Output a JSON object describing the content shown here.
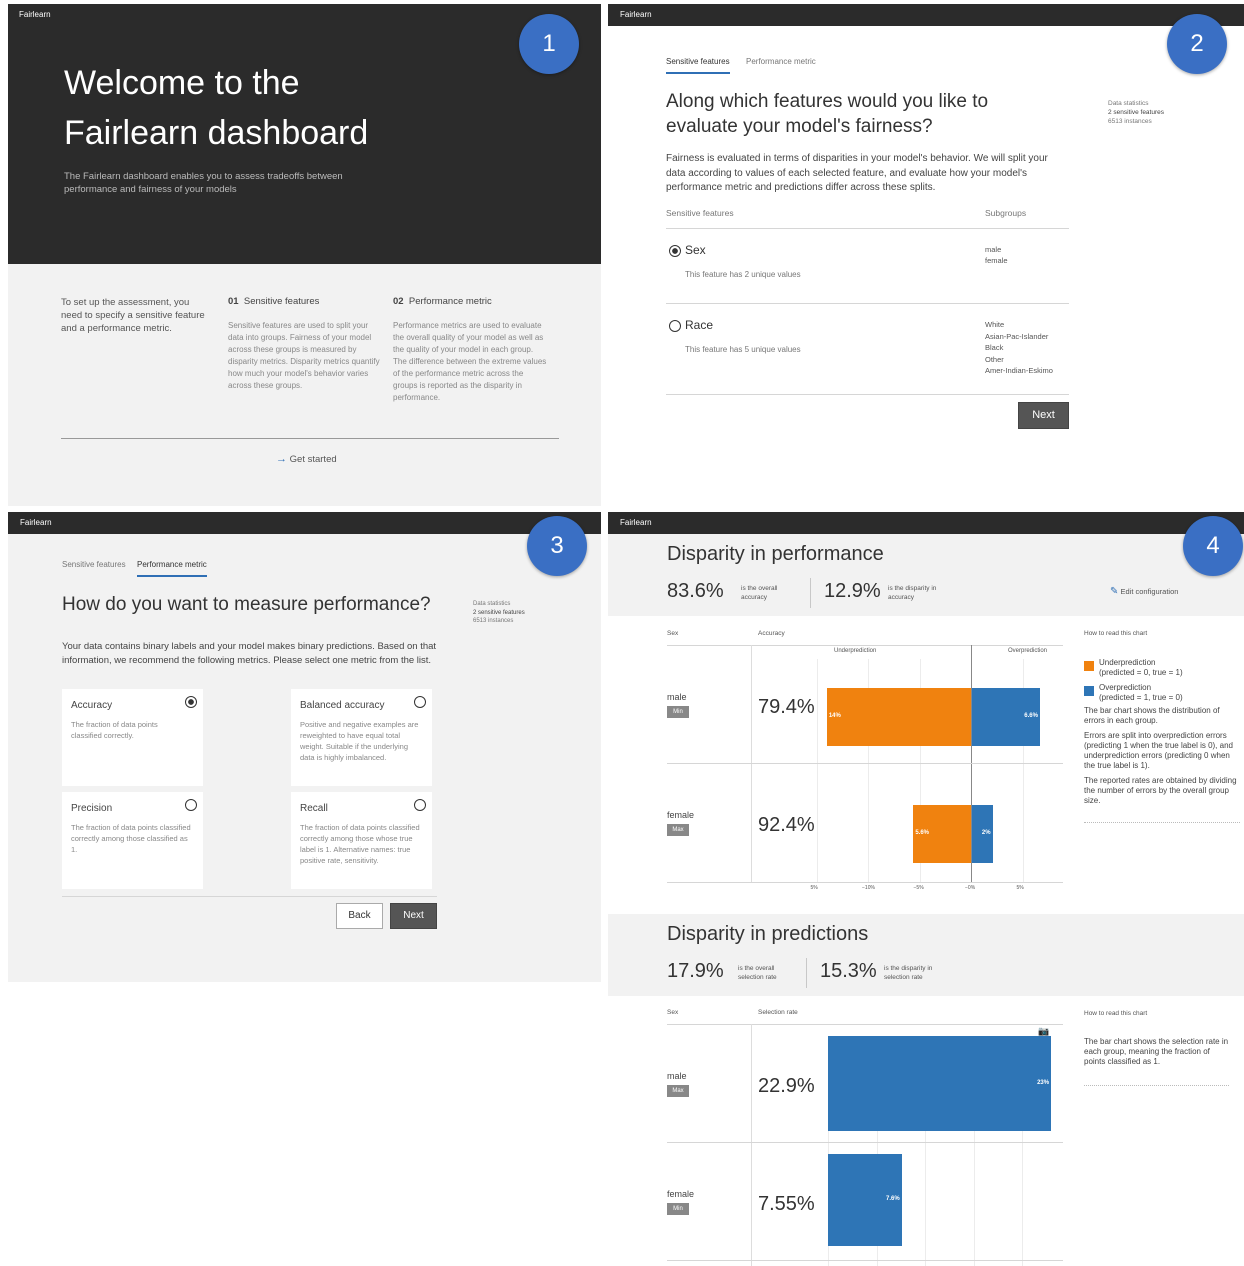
{
  "app_name": "Fairlearn",
  "badges": [
    "1",
    "2",
    "3",
    "4"
  ],
  "panel1": {
    "heading": "Welcome to the Fairlearn dashboard",
    "heading_line1": "Welcome to the",
    "heading_line2": "Fairlearn dashboard",
    "subtitle": "The Fairlearn dashboard enables you to assess tradeoffs between performance and fairness of your models",
    "intro": "To set up the assessment, you need to specify a sensitive feature and a performance metric.",
    "step1_num": "01",
    "step1_title": "Sensitive features",
    "step1_text": "Sensitive features are used to split your data into groups. Fairness of your model across these groups is measured by disparity metrics. Disparity metrics quantify how much your model's behavior varies across these groups.",
    "step2_num": "02",
    "step2_title": "Performance metric",
    "step2_text": "Performance metrics are used to evaluate the overall quality of your model as well as the quality of your model in each group. The difference between the extreme values of the performance metric across the groups is reported as the disparity in performance.",
    "get_started": "Get started"
  },
  "panel2": {
    "tabs": [
      "Sensitive features",
      "Performance metric"
    ],
    "heading": "Along which features would you like to evaluate your model's fairness?",
    "description": "Fairness is evaluated in terms of disparities in your model's behavior. We will split your data according to values of each selected feature, and evaluate how your model's performance metric and predictions differ across these splits.",
    "col_features": "Sensitive features",
    "col_subgroups": "Subgroups",
    "stats_title": "Data statistics",
    "stats_features": "2 sensitive features",
    "stats_instances": "6513 instances",
    "features": [
      {
        "name": "Sex",
        "selected": true,
        "note": "This feature has 2 unique values",
        "subgroups": [
          "male",
          "female"
        ]
      },
      {
        "name": "Race",
        "selected": false,
        "note": "This feature has 5 unique values",
        "subgroups": [
          "White",
          "Asian-Pac-Islander",
          "Black",
          "Other",
          "Amer-Indian-Eskimo"
        ]
      }
    ],
    "next": "Next"
  },
  "panel3": {
    "tabs": [
      "Sensitive features",
      "Performance metric"
    ],
    "heading": "How do you want to measure performance?",
    "stats_title": "Data statistics",
    "stats_features": "2 sensitive features",
    "stats_instances": "6513 instances",
    "description": "Your data contains binary labels and your model makes binary predictions. Based on that information, we recommend the following metrics. Please select one metric from the list.",
    "metrics": [
      {
        "name": "Accuracy",
        "text": "The fraction of data points classified correctly.",
        "selected": true
      },
      {
        "name": "Balanced accuracy",
        "text": "Positive and negative examples are reweighted to have equal total weight. Suitable if the underlying data is highly imbalanced.",
        "selected": false
      },
      {
        "name": "Precision",
        "text": "The fraction of data points classified correctly among those classified as 1.",
        "selected": false
      },
      {
        "name": "Recall",
        "text": "The fraction of data points classified correctly among those whose true label is 1. Alternative names: true positive rate, sensitivity.",
        "selected": false
      }
    ],
    "back": "Back",
    "next": "Next"
  },
  "panel4": {
    "perf": {
      "title": "Disparity in performance",
      "overall_value": "83.6%",
      "overall_label": "is the overall accuracy",
      "disparity_value": "12.9%",
      "disparity_label": "is the disparity in accuracy",
      "edit": "Edit configuration",
      "col_sex": "Sex",
      "col_metric": "Accuracy",
      "under_label": "Underprediction",
      "over_label": "Overprediction",
      "rows": [
        {
          "group": "male",
          "tag": "Min",
          "value": "79.4%",
          "under": 14,
          "over": 6.6,
          "under_label": "14%",
          "over_label": "6.6%"
        },
        {
          "group": "female",
          "tag": "Max",
          "value": "92.4%",
          "under": 5.6,
          "over": 2,
          "under_label": "5.6%",
          "over_label": "2%"
        }
      ],
      "axis_ticks": [
        "5%",
        "−10%",
        "−5%",
        "−0%",
        "5%"
      ],
      "legend_title": "How to read this chart",
      "legend_under": "Underprediction",
      "legend_under_sub": "(predicted = 0, true = 1)",
      "legend_over": "Overprediction",
      "legend_over_sub": "(predicted = 1, true = 0)",
      "legend_p1": "The bar chart shows the distribution of errors in each group.",
      "legend_p2": "Errors are split into overprediction errors (predicting 1 when the true label is 0), and underprediction errors (predicting 0 when the true label is 1).",
      "legend_p3": "The reported rates are obtained by dividing the number of errors by the overall group size."
    },
    "pred": {
      "title": "Disparity in predictions",
      "overall_value": "17.9%",
      "overall_label": "is the overall selection rate",
      "disparity_value": "15.3%",
      "disparity_label": "is the disparity in selection rate",
      "col_sex": "Sex",
      "col_metric": "Selection rate",
      "rows": [
        {
          "group": "male",
          "tag": "Max",
          "value": "22.9%",
          "rate": 23,
          "bar_label": "23%"
        },
        {
          "group": "female",
          "tag": "Min",
          "value": "7.55%",
          "rate": 7.6,
          "bar_label": "7.6%"
        }
      ],
      "legend_title": "How to read this chart",
      "legend_p1": "The bar chart shows the selection rate in each group, meaning the fraction of points classified as 1."
    }
  },
  "colors": {
    "underprediction": "#f0820f",
    "overprediction": "#2e75b6",
    "badge": "#3a6fc4",
    "header": "#2b2b2b"
  }
}
